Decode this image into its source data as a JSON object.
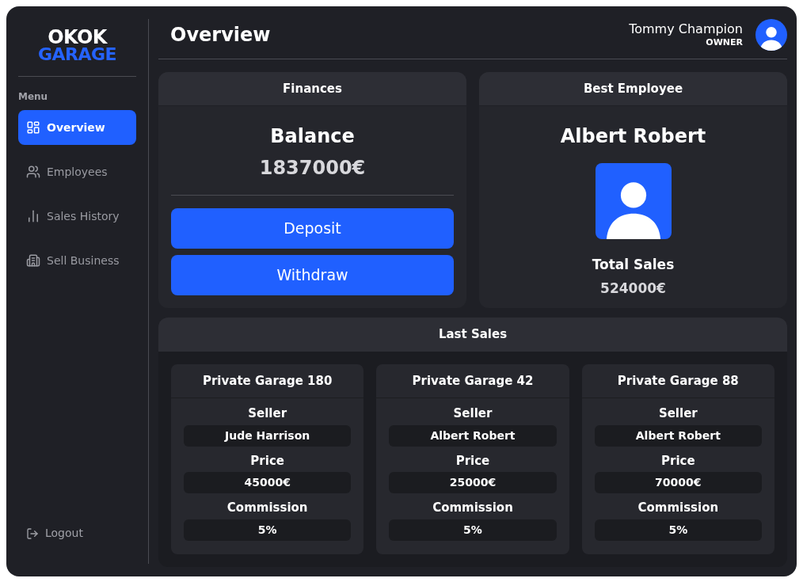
{
  "logo": {
    "line_1": "OKOK",
    "line_2": "GARAGE"
  },
  "sidebar": {
    "heading": "Menu",
    "items": [
      {
        "label": "Overview",
        "selected": true
      },
      {
        "label": "Employees",
        "selected": false
      },
      {
        "label": "Sales History",
        "selected": false
      },
      {
        "label": "Sell Business",
        "selected": false
      }
    ],
    "logout": "Logout"
  },
  "header": {
    "title": "Overview",
    "user_name": "Tommy Champion",
    "user_role": "OWNER"
  },
  "finances": {
    "title": "Finances",
    "balance_label": "Balance",
    "balance": "1837000€",
    "buttons": [
      "Deposit",
      "Withdraw"
    ]
  },
  "best_employee": {
    "title": "Best Employee",
    "name": "Albert Robert",
    "sales_label": "Total Sales",
    "sales": "524000€"
  },
  "last_sales": {
    "title": "Last Sales",
    "sales": [
      {
        "name": "Private Garage 180",
        "seller_label": "Seller",
        "seller": "Jude Harrison",
        "price_label": "Price",
        "price": "45000€",
        "commission_label": "Commission",
        "commission": "5%"
      },
      {
        "name": "Private Garage 42",
        "seller_label": "Seller",
        "seller": "Albert Robert",
        "price_label": "Price",
        "price": "25000€",
        "commission_label": "Commission",
        "commission": "5%"
      },
      {
        "name": "Private Garage 88",
        "seller_label": "Seller",
        "seller": "Albert Robert",
        "price_label": "Price",
        "price": "70000€",
        "commission_label": "Commission",
        "commission": "5%"
      }
    ]
  }
}
